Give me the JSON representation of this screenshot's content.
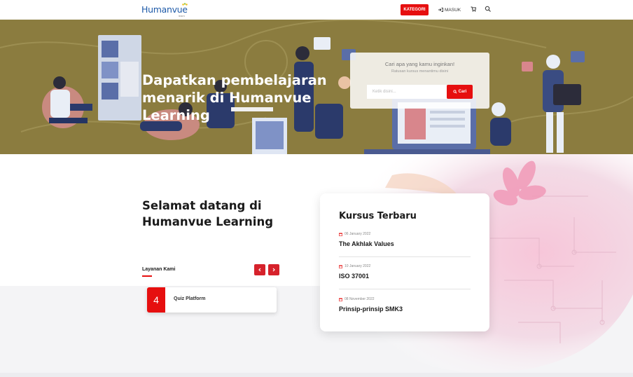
{
  "nav": {
    "logo_text": "Humanvue",
    "logo_sub": "learn",
    "kategori_label": "KATEGORI",
    "masuk_label": "MASUK",
    "cart_icon": "cart-icon",
    "search_icon": "search-icon"
  },
  "hero": {
    "title": "Dapatkan pembelajaran menarik di Humanvue Learning",
    "search_question": "Cari apa yang kamu inginkan!",
    "search_sub": "Ratusan kursus menantimu disini",
    "search_placeholder": "Ketik disini...",
    "search_button": "Cari"
  },
  "welcome": {
    "title": "Selamat datang di Humanvue Learning",
    "layanan_label": "Layanan Kami"
  },
  "services": [
    {
      "number": "4",
      "label": "Quiz Platform"
    }
  ],
  "courses": {
    "title": "Kursus Terbaru",
    "items": [
      {
        "date": "06 January 2022",
        "name": "The Akhlak Values"
      },
      {
        "date": "10 January 2022",
        "name": "ISO 37001"
      },
      {
        "date": "08 November 2022",
        "name": "Prinsip-prinsip SMK3"
      }
    ]
  },
  "colors": {
    "accent": "#e60f0f",
    "hero_bg": "#8b7c3f",
    "brand_blue": "#1e5aa8"
  }
}
